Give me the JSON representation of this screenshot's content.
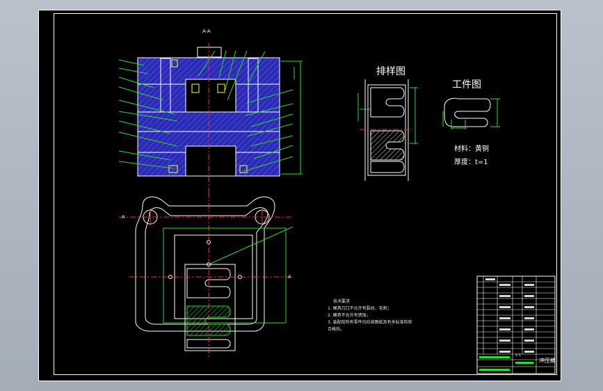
{
  "drawing": {
    "section_label": "A-A",
    "layout_title": "排样图",
    "part_title": "工件图",
    "material_label": "材料：",
    "material_value": "黄铜",
    "thickness_label": "厚度：",
    "thickness_value": "t=1",
    "plan_label_left": "A",
    "plan_label_right": "A"
  },
  "notes": {
    "title": "技术要求",
    "items": [
      "1. 模具刃口不允许有裂纹、毛刺；",
      "2. 模具不允许有锈蚀；",
      "3. 装配前所有零件均应按图纸及有关标准检验",
      "    合格后。"
    ]
  },
  "title_block": {
    "drawing_name": "冲压模",
    "scale": "1:1"
  },
  "colors": {
    "background": "#000000",
    "frame": "#ffffff",
    "part_fill": "#2a2ab4",
    "centerline": "#ff2a2a",
    "dimension": "#2bdc2b",
    "leader": "#2bdc2b",
    "hatch": "#ffffff"
  }
}
